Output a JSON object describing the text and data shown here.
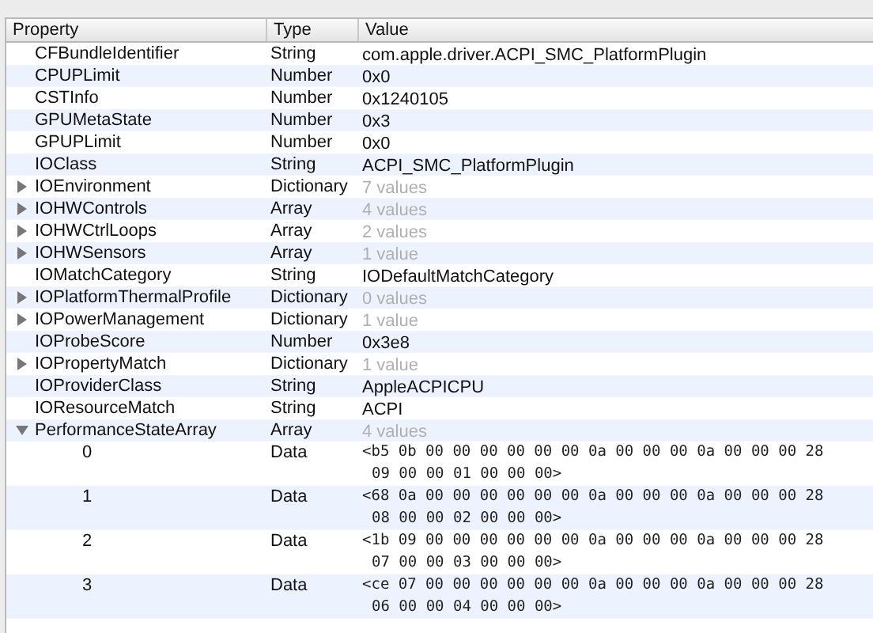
{
  "table": {
    "columns": [
      "Property",
      "Type",
      "Value"
    ],
    "rows": [
      {
        "kind": "leaf",
        "name": "CFBundleIdentifier",
        "type": "String",
        "value": "com.apple.driver.ACPI_SMC_PlatformPlugin"
      },
      {
        "kind": "leaf",
        "name": "CPUPLimit",
        "type": "Number",
        "value": "0x0"
      },
      {
        "kind": "leaf",
        "name": "CSTInfo",
        "type": "Number",
        "value": "0x1240105"
      },
      {
        "kind": "leaf",
        "name": "GPUMetaState",
        "type": "Number",
        "value": "0x3"
      },
      {
        "kind": "leaf",
        "name": "GPUPLimit",
        "type": "Number",
        "value": "0x0"
      },
      {
        "kind": "leaf",
        "name": "IOClass",
        "type": "String",
        "value": "ACPI_SMC_PlatformPlugin"
      },
      {
        "kind": "container",
        "expanded": false,
        "name": "IOEnvironment",
        "type": "Dictionary",
        "value": "7 values"
      },
      {
        "kind": "container",
        "expanded": false,
        "name": "IOHWControls",
        "type": "Array",
        "value": "4 values"
      },
      {
        "kind": "container",
        "expanded": false,
        "name": "IOHWCtrlLoops",
        "type": "Array",
        "value": "2 values"
      },
      {
        "kind": "container",
        "expanded": false,
        "name": "IOHWSensors",
        "type": "Array",
        "value": "1 value"
      },
      {
        "kind": "leaf",
        "name": "IOMatchCategory",
        "type": "String",
        "value": "IODefaultMatchCategory"
      },
      {
        "kind": "container",
        "expanded": false,
        "name": "IOPlatformThermalProfile",
        "type": "Dictionary",
        "value": "0 values"
      },
      {
        "kind": "container",
        "expanded": false,
        "name": "IOPowerManagement",
        "type": "Dictionary",
        "value": "1 value"
      },
      {
        "kind": "leaf",
        "name": "IOProbeScore",
        "type": "Number",
        "value": "0x3e8"
      },
      {
        "kind": "container",
        "expanded": false,
        "name": "IOPropertyMatch",
        "type": "Dictionary",
        "value": "1 value"
      },
      {
        "kind": "leaf",
        "name": "IOProviderClass",
        "type": "String",
        "value": "AppleACPICPU"
      },
      {
        "kind": "leaf",
        "name": "IOResourceMatch",
        "type": "String",
        "value": "ACPI"
      },
      {
        "kind": "container",
        "expanded": true,
        "name": "PerformanceStateArray",
        "type": "Array",
        "value": "4 values",
        "children": [
          {
            "kind": "data",
            "name": "0",
            "type": "Data",
            "value_lines": [
              "<b5 0b 00 00 00 00 00 00 0a 00 00 00 0a 00 00 00 28",
              "09 00 00 01 00 00 00>"
            ]
          },
          {
            "kind": "data",
            "name": "1",
            "type": "Data",
            "value_lines": [
              "<68 0a 00 00 00 00 00 00 0a 00 00 00 0a 00 00 00 28",
              "08 00 00 02 00 00 00>"
            ]
          },
          {
            "kind": "data",
            "name": "2",
            "type": "Data",
            "value_lines": [
              "<1b 09 00 00 00 00 00 00 0a 00 00 00 0a 00 00 00 28",
              "07 00 00 03 00 00 00>"
            ]
          },
          {
            "kind": "data",
            "name": "3",
            "type": "Data",
            "value_lines": [
              "<ce 07 00 00 00 00 00 00 0a 00 00 00 0a 00 00 00 28",
              "06 00 00 04 00 00 00>"
            ]
          }
        ]
      }
    ]
  }
}
